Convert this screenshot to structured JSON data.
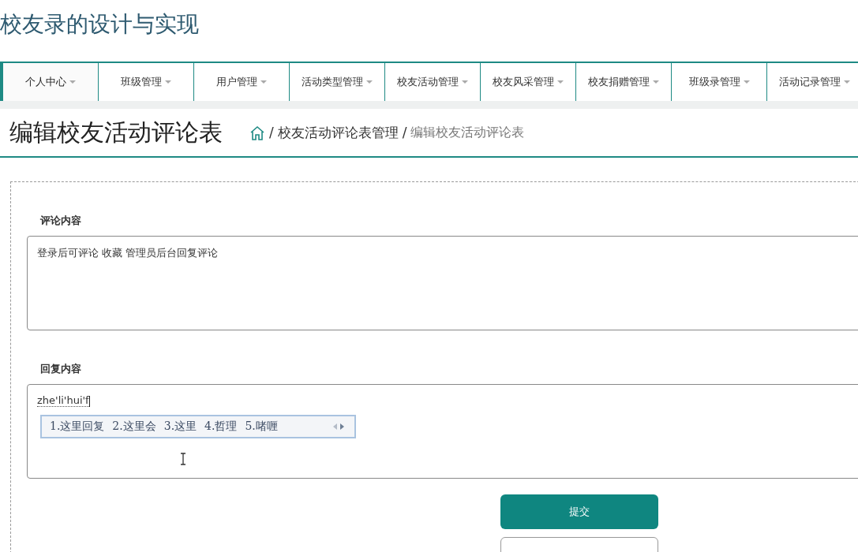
{
  "site_title": "校友录的设计与实现",
  "nav": [
    {
      "label": "个人中心",
      "selected": true
    },
    {
      "label": "班级管理",
      "selected": false
    },
    {
      "label": "用户管理",
      "selected": false
    },
    {
      "label": "活动类型管理",
      "selected": false
    },
    {
      "label": "校友活动管理",
      "selected": false
    },
    {
      "label": "校友风采管理",
      "selected": false
    },
    {
      "label": "校友捐赠管理",
      "selected": false
    },
    {
      "label": "班级录管理",
      "selected": false
    },
    {
      "label": "活动记录管理",
      "selected": false
    }
  ],
  "page_title": "编辑校友活动评论表",
  "breadcrumb": [
    {
      "separator": "/",
      "label": "校友活动评论表管理"
    },
    {
      "separator": "/",
      "label": "编辑校友活动评论表"
    }
  ],
  "form": {
    "fields": [
      {
        "label": "评论内容",
        "value": "登录后可评论 收藏 管理员后台回复评论"
      },
      {
        "label": "回复内容",
        "value": "zhe'li'hui'f",
        "ime_candidates": [
          "1.这里回复",
          "2.这里会",
          "3.这里",
          "4.哲理",
          "5.啫喱"
        ]
      }
    ],
    "submit": "提交"
  }
}
